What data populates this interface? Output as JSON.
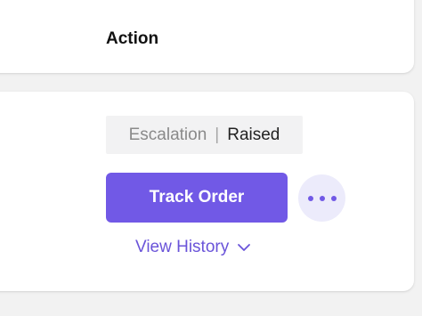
{
  "header": {
    "title": "Action"
  },
  "status": {
    "label": "Escalation",
    "separator": "|",
    "value": "Raised"
  },
  "actions": {
    "primary_label": "Track Order",
    "more_icon": "more-horizontal-icon",
    "history_label": "View History",
    "history_icon": "chevron-down-icon"
  },
  "colors": {
    "accent": "#7159e6",
    "accent_light": "#ecebfb",
    "link": "#6a54d9"
  }
}
